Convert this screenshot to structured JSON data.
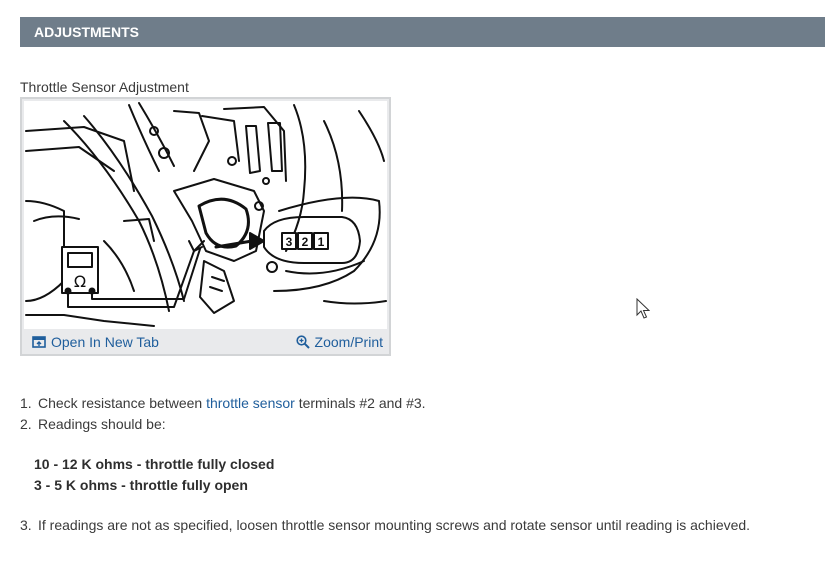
{
  "header": {
    "title": "ADJUSTMENTS"
  },
  "figure": {
    "caption": "Throttle Sensor Adjustment",
    "connector_terminals": [
      "3",
      "2",
      "1"
    ],
    "meter_symbol": "Ω",
    "open_label": "Open In New Tab",
    "zoom_label": "Zoom/Print"
  },
  "steps": [
    {
      "num": "1.",
      "before": "Check resistance between ",
      "link": "throttle sensor",
      "after": " terminals #2 and #3."
    },
    {
      "num": "2.",
      "text": "Readings should be:"
    },
    {
      "num": "3.",
      "text": "If readings are not as specified, loosen throttle sensor mounting screws and rotate sensor until reading is achieved."
    }
  ],
  "readings": [
    "10 - 12 K ohms - throttle fully closed",
    "3 - 5 K ohms - throttle fully open"
  ]
}
